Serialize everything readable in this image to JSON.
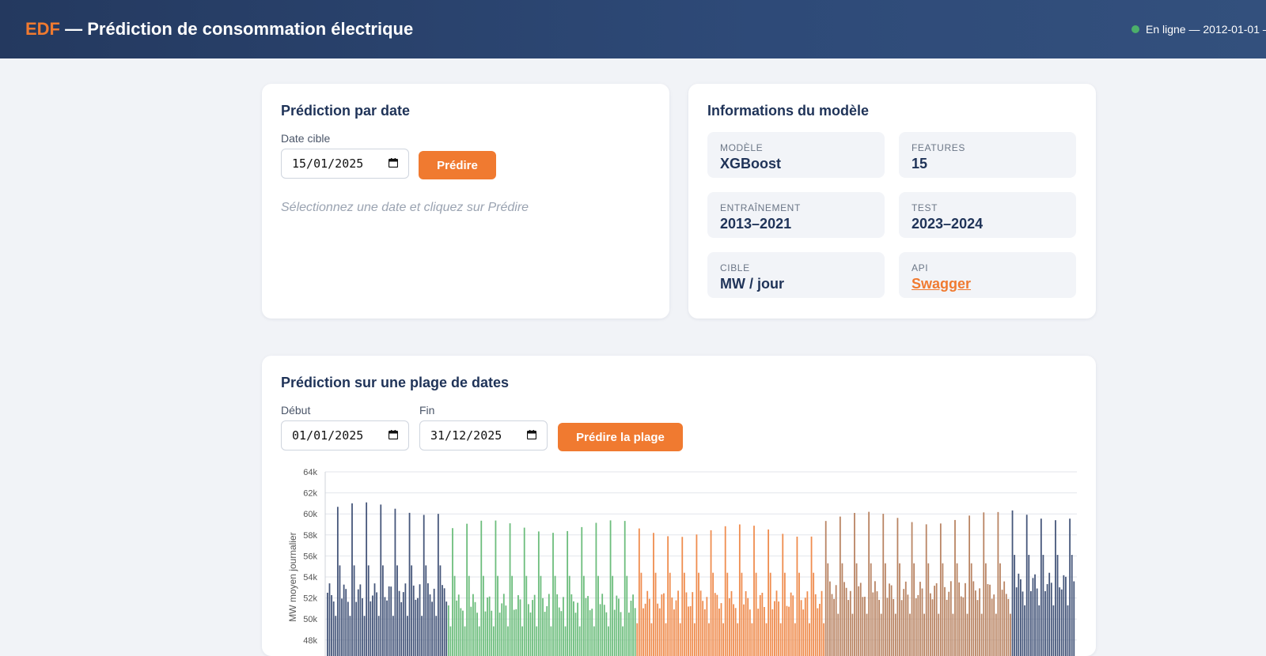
{
  "header": {
    "brand": "EDF",
    "title": "— Prédiction de consommation électrique",
    "status": "En ligne — 2012-01-01 –"
  },
  "single_prediction": {
    "title": "Prédiction par date",
    "date_label": "Date cible",
    "date_value": "15/01/2025",
    "button": "Prédire",
    "hint": "Sélectionnez une date et cliquez sur Prédire"
  },
  "model_info": {
    "title": "Informations du modèle",
    "tiles": [
      {
        "key": "Modèle",
        "value": "XGBoost"
      },
      {
        "key": "Features",
        "value": "15"
      },
      {
        "key": "Entraînement",
        "value": "2013–2021"
      },
      {
        "key": "Test",
        "value": "2023–2024"
      },
      {
        "key": "Cible",
        "value": "MW / jour"
      },
      {
        "key": "API",
        "value": "Swagger"
      }
    ]
  },
  "range_prediction": {
    "title": "Prédiction sur une plage de dates",
    "start_label": "Début",
    "start_value": "01/01/2025",
    "end_label": "Fin",
    "end_value": "31/12/2025",
    "button": "Prédire la plage"
  },
  "colors": {
    "accent": "#f07a30",
    "winter": "#45567a",
    "spring": "#6cbd7c",
    "summer": "#ef8c4e",
    "autumn": "#b98463"
  },
  "chart_data": {
    "type": "bar",
    "ylabel": "MW moyen journalier",
    "ylim": [
      48000,
      64000
    ],
    "yticks": [
      "64k",
      "62k",
      "60k",
      "58k",
      "56k",
      "54k",
      "52k",
      "50k",
      "48k"
    ],
    "grid": true,
    "segments": [
      {
        "season": "winter",
        "days": 59,
        "base": 52500,
        "peak": 60500
      },
      {
        "season": "spring",
        "days": 92,
        "base": 51500,
        "peak": 58800
      },
      {
        "season": "summer",
        "days": 92,
        "base": 51800,
        "peak": 58400
      },
      {
        "season": "autumn",
        "days": 91,
        "base": 52700,
        "peak": 59600
      },
      {
        "season": "winter",
        "days": 31,
        "base": 53500,
        "peak": 60000
      }
    ]
  }
}
